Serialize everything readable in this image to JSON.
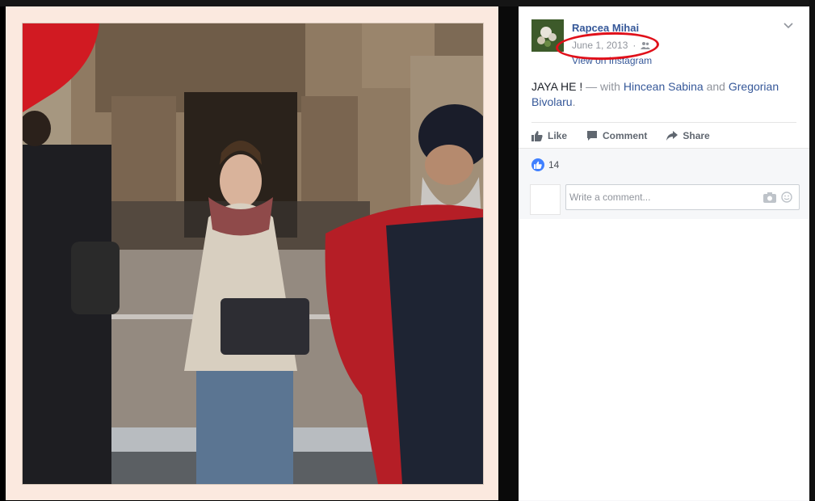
{
  "post": {
    "author": "Rapcea Mihai",
    "date": "June 1, 2013",
    "audience_icon": "friends-icon",
    "via_link": "View on Instagram",
    "caption": {
      "text": "JAYA HE !",
      "with_prefix": "— with",
      "person1": "Hincean Sabina",
      "conjunction": "and",
      "person2": "Gregorian Bivolaru",
      "end": "."
    },
    "actions": {
      "like": "Like",
      "comment": "Comment",
      "share": "Share"
    },
    "like_count": "14",
    "comment_placeholder": "Write a comment..."
  },
  "colors": {
    "link": "#365899",
    "highlight_ring": "#e0101a",
    "like_blue": "#4080ff",
    "frame": "#fbe9df"
  }
}
